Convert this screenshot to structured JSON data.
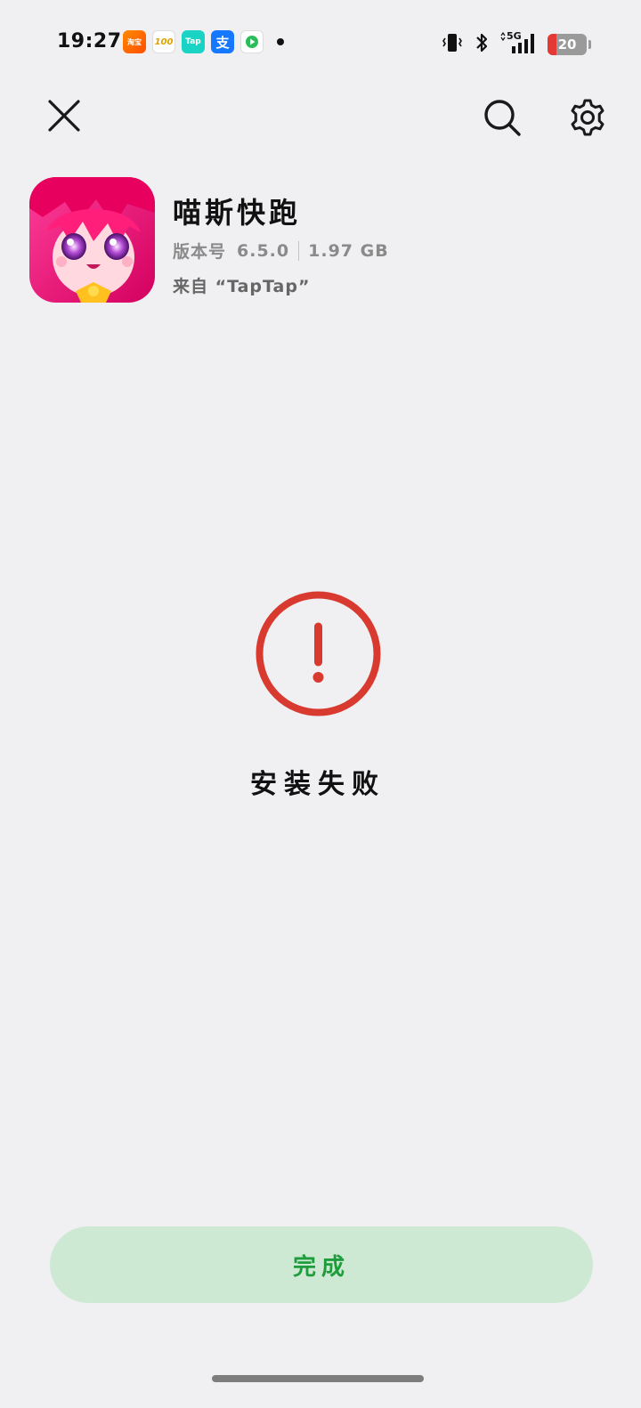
{
  "status_bar": {
    "time": "19:27",
    "notification_apps": [
      {
        "name": "taobao-flash",
        "label": "淘宝\n闪购"
      },
      {
        "name": "app-100",
        "label": "100"
      },
      {
        "name": "taptap",
        "label": "Tap"
      },
      {
        "name": "alipay",
        "label": "支"
      },
      {
        "name": "video-app",
        "label": ""
      }
    ],
    "network": "5G",
    "battery_level": "20"
  },
  "app": {
    "name": "喵斯快跑",
    "version_label": "版本号",
    "version": "6.5.0",
    "size": "1.97 GB",
    "source": "来自 “TapTap”"
  },
  "result": {
    "status_text": "安装失败",
    "icon_color": "#d93a2f"
  },
  "actions": {
    "done_label": "完成",
    "done_bg": "#cde9d3",
    "done_text_color": "#1f9c3c"
  }
}
